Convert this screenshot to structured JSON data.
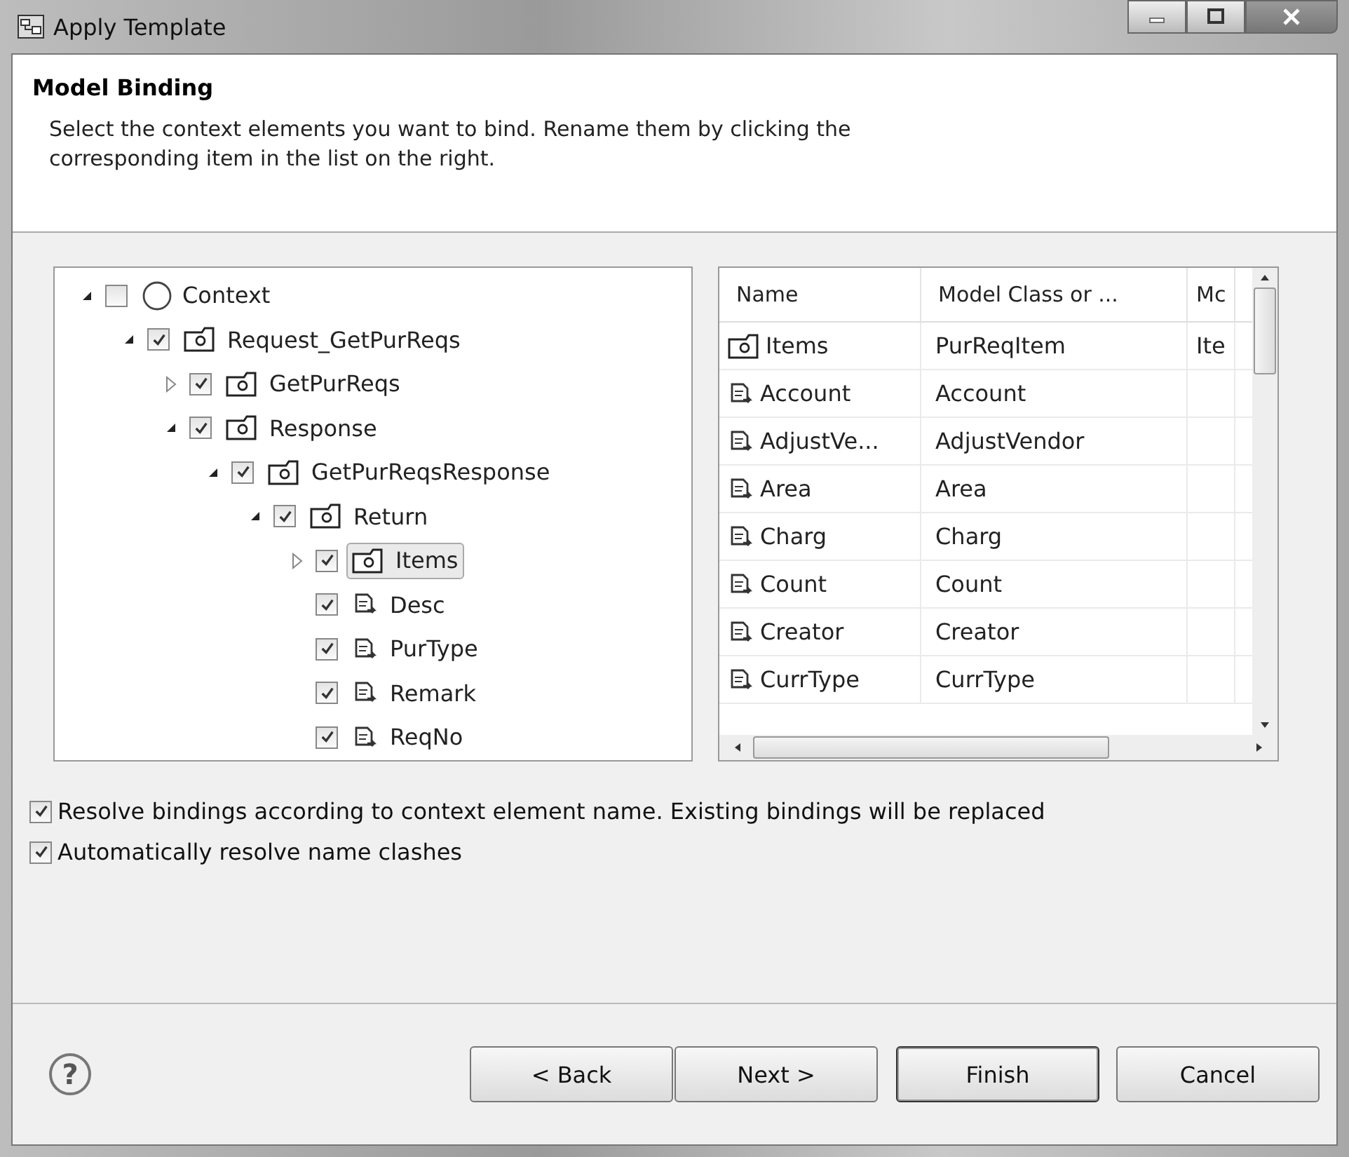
{
  "window": {
    "title": "Apply Template"
  },
  "header": {
    "title": "Model Binding",
    "description": "Select the context elements you want to bind. Rename them by clicking the corresponding item in the list on the right."
  },
  "tree": [
    {
      "label": "Context",
      "kind": "context",
      "checked": false,
      "expanded": true,
      "selected": false,
      "children": [
        {
          "label": "Request_GetPurReqs",
          "kind": "node",
          "checked": true,
          "expanded": true,
          "selected": false,
          "children": [
            {
              "label": "GetPurReqs",
              "kind": "node",
              "checked": true,
              "expanded": false,
              "selected": false
            },
            {
              "label": "Response",
              "kind": "node",
              "checked": true,
              "expanded": true,
              "selected": false,
              "children": [
                {
                  "label": "GetPurReqsResponse",
                  "kind": "node",
                  "checked": true,
                  "expanded": true,
                  "selected": false,
                  "children": [
                    {
                      "label": "Return",
                      "kind": "node",
                      "checked": true,
                      "expanded": true,
                      "selected": false,
                      "children": [
                        {
                          "label": "Items",
                          "kind": "node",
                          "checked": true,
                          "expanded": false,
                          "selected": true
                        },
                        {
                          "label": "Desc",
                          "kind": "attribute",
                          "checked": true,
                          "selected": false
                        },
                        {
                          "label": "PurType",
                          "kind": "attribute",
                          "checked": true,
                          "selected": false
                        },
                        {
                          "label": "Remark",
                          "kind": "attribute",
                          "checked": true,
                          "selected": false
                        },
                        {
                          "label": "ReqNo",
                          "kind": "attribute",
                          "checked": true,
                          "selected": false
                        }
                      ]
                    }
                  ]
                }
              ]
            }
          ]
        }
      ]
    }
  ],
  "table": {
    "columns": [
      "Name",
      "Model Class or ...",
      "Mc"
    ],
    "rows": [
      {
        "kind": "node",
        "cells": [
          "Items",
          "PurReqItem",
          "Ite"
        ]
      },
      {
        "kind": "attribute",
        "cells": [
          "Account",
          "Account",
          ""
        ]
      },
      {
        "kind": "attribute",
        "cells": [
          "AdjustVe...",
          "AdjustVendor",
          ""
        ]
      },
      {
        "kind": "attribute",
        "cells": [
          "Area",
          "Area",
          ""
        ]
      },
      {
        "kind": "attribute",
        "cells": [
          "Charg",
          "Charg",
          ""
        ]
      },
      {
        "kind": "attribute",
        "cells": [
          "Count",
          "Count",
          ""
        ]
      },
      {
        "kind": "attribute",
        "cells": [
          "Creator",
          "Creator",
          ""
        ]
      },
      {
        "kind": "attribute",
        "cells": [
          "CurrType",
          "CurrType",
          ""
        ]
      }
    ]
  },
  "options": [
    {
      "label": "Resolve bindings according to context element name. Existing bindings will be replaced",
      "checked": true
    },
    {
      "label": "Automatically resolve name clashes",
      "checked": true
    }
  ],
  "help": "?",
  "buttons": [
    {
      "label": "< Back",
      "kind": "grouped"
    },
    {
      "label": "Next >",
      "kind": "grouped"
    },
    {
      "label": "Finish",
      "kind": "default"
    },
    {
      "label": "Cancel",
      "kind": "plain"
    }
  ]
}
